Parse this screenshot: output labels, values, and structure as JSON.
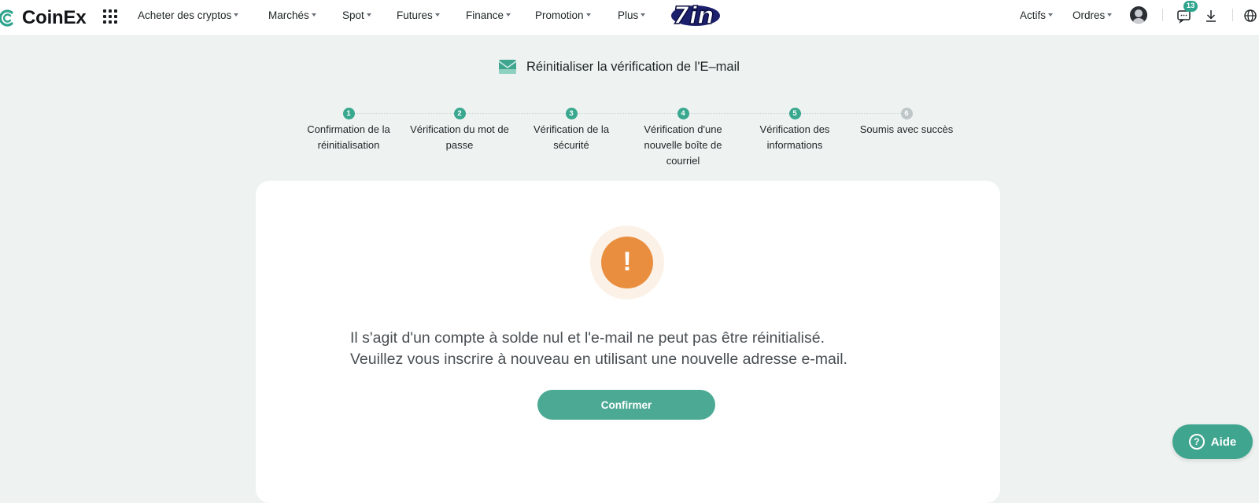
{
  "brand": {
    "name": "CoinEx",
    "accent": "#3fa58f"
  },
  "nav": {
    "items": [
      {
        "label": "Acheter des cryptos"
      },
      {
        "label": "Marchés"
      },
      {
        "label": "Spot"
      },
      {
        "label": "Futures"
      },
      {
        "label": "Finance"
      },
      {
        "label": "Promotion"
      },
      {
        "label": "Plus"
      }
    ],
    "promo_badge": "7in",
    "right": {
      "assets": "Actifs",
      "orders": "Ordres",
      "notifications_count": "13"
    }
  },
  "page": {
    "title": "Réinitialiser la vérification de l'E–mail"
  },
  "stepper": {
    "steps": [
      {
        "num": "1",
        "label": "Confirmation de la réinitialisation",
        "state": "done"
      },
      {
        "num": "2",
        "label": "Vérification du mot de passe",
        "state": "done"
      },
      {
        "num": "3",
        "label": "Vérification de la sécurité",
        "state": "done"
      },
      {
        "num": "4",
        "label": "Vérification d'une nouvelle boîte de courriel",
        "state": "done"
      },
      {
        "num": "5",
        "label": "Vérification des informations",
        "state": "done"
      },
      {
        "num": "6",
        "label": "Soumis avec succès",
        "state": "pending"
      }
    ]
  },
  "card": {
    "icon": "warning-icon",
    "message_line1": "Il s'agit d'un compte à solde nul et l'e-mail ne peut pas être réinitialisé.",
    "message_line2": "Veuillez vous inscrire à nouveau en utilisant une nouvelle adresse e-mail.",
    "confirm_label": "Confirmer"
  },
  "help": {
    "label": "Aide"
  }
}
